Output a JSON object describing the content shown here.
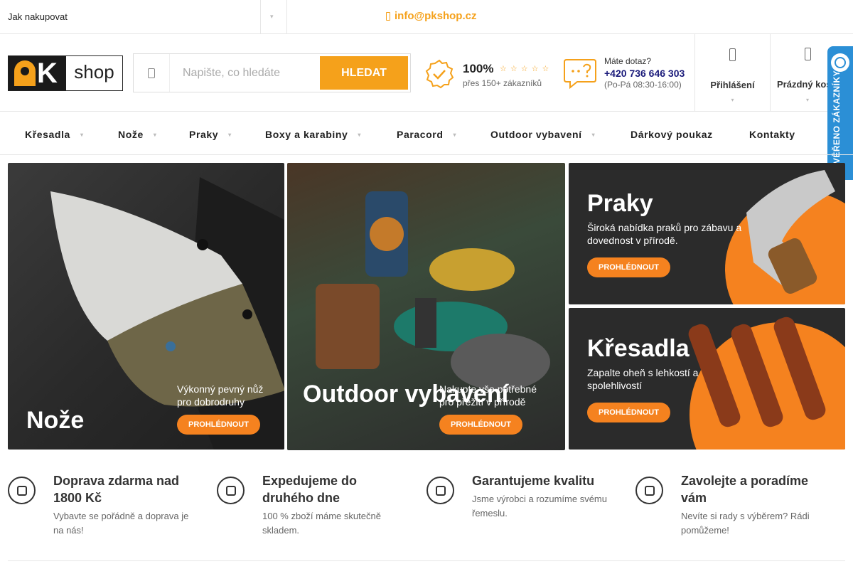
{
  "topbar": {
    "how_to_buy": "Jak nakupovat",
    "email": "info@pkshop.cz"
  },
  "logo": {
    "mark": "K",
    "word": "shop"
  },
  "search": {
    "placeholder": "Napište, co hledáte",
    "button": "HLEDAT"
  },
  "rating": {
    "percent": "100%",
    "customers": "přes 150+ zákazníků",
    "stars": "☆☆☆☆☆"
  },
  "contact": {
    "question": "Máte dotaz?",
    "phone": "+420 736 646 303",
    "hours": "(Po-Pá 08:30-16:00)"
  },
  "account": {
    "login": "Přihlášení",
    "cart": "Prázdný košík"
  },
  "verified_badge": {
    "text": "OVĚŘENO ZÁKAZNÍKY",
    "color": "#2b8fd6"
  },
  "nav": {
    "items": [
      {
        "label": "Křesadla"
      },
      {
        "label": "Nože"
      },
      {
        "label": "Praky"
      },
      {
        "label": "Boxy a karabiny"
      },
      {
        "label": "Paracord"
      },
      {
        "label": "Outdoor vybavení"
      },
      {
        "label": "Dárkový poukaz"
      },
      {
        "label": "Kontakty"
      }
    ]
  },
  "banners": {
    "knife": {
      "title": "Nože",
      "text": "Výkonný pevný nůž pro dobrodruhy",
      "cta": "PROHLÉDNOUT"
    },
    "outdoor": {
      "title": "Outdoor vybavení",
      "text": "Nakupte vše potřebné pro přežití v přírodě",
      "cta": "PROHLÉDNOUT"
    },
    "praky": {
      "title": "Praky",
      "text": "Široká nabídka praků pro zábavu a dovednost v přírodě.",
      "cta": "PROHLÉDNOUT"
    },
    "kresadla": {
      "title": "Křesadla",
      "text": "Zapalte oheň s lehkostí a spolehlivostí",
      "cta": "PROHLÉDNOUT"
    }
  },
  "features": [
    {
      "title": "Doprava zdarma nad 1800 Kč",
      "desc": "Vybavte se pořádně a doprava je na nás!"
    },
    {
      "title": "Expedujeme do druhého dne",
      "desc": "100 % zboží máme skutečně skladem."
    },
    {
      "title": "Garantujeme kvalitu",
      "desc": "Jsme výrobci a rozumíme svému řemeslu."
    },
    {
      "title": "Zavolejte a poradíme vám",
      "desc": "Nevíte si rady s výběrem? Rádi pomůžeme!"
    }
  ],
  "colors": {
    "accent": "#f5a11b",
    "cta": "#f5821f",
    "verified": "#2b8fd6"
  }
}
